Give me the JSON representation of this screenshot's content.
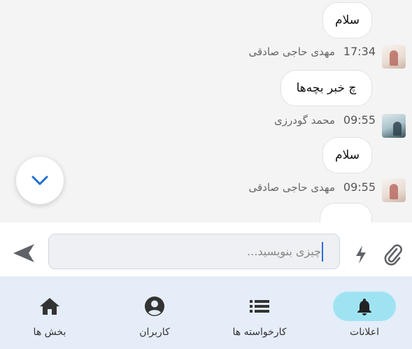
{
  "messages": [
    {
      "text": "سلام",
      "sender": "مهدی حاجی صادقی",
      "time": "17:34"
    },
    {
      "text": "چ خبر بچه‌ها",
      "sender": "محمد گودرزی",
      "time": "09:55"
    },
    {
      "text": "سلام",
      "sender": "مهدی حاجی صادقی",
      "time": "09:55"
    }
  ],
  "composer": {
    "placeholder": "چیزی بنویسید..."
  },
  "nav": {
    "items": [
      {
        "label": "اعلانات",
        "icon": "bell-icon",
        "active": true
      },
      {
        "label": "کارخواسته ها",
        "icon": "list-icon",
        "active": false
      },
      {
        "label": "کاربران",
        "icon": "account-circle-icon",
        "active": false
      },
      {
        "label": "بخش ها",
        "icon": "home-icon",
        "active": false
      }
    ]
  },
  "colors": {
    "accent": "#2f6bd8",
    "active_nav_pill": "#9fe3f3",
    "nav_background": "#e4edf8",
    "chat_background": "#f4f4f4"
  }
}
